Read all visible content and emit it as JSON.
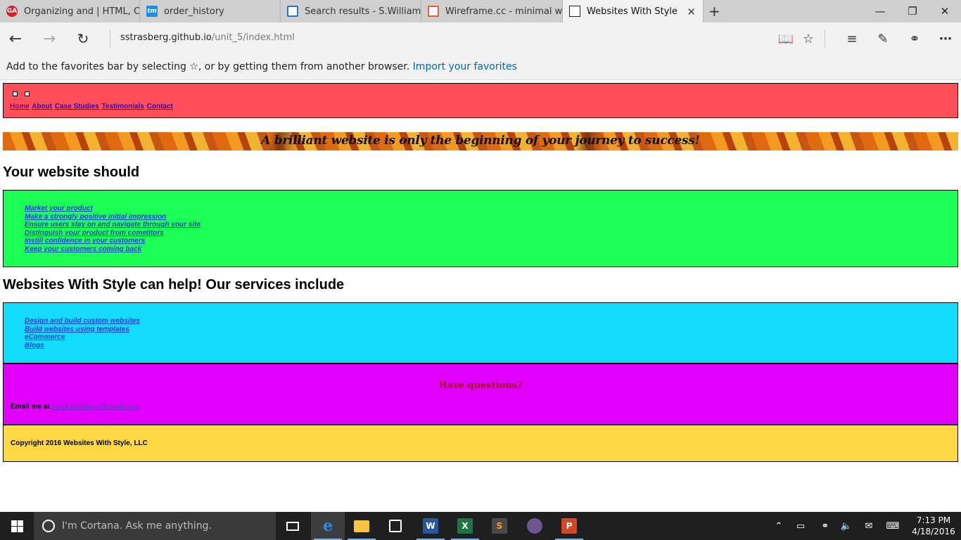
{
  "browser": {
    "tabs": [
      {
        "title": "Organizing and | HTML, CSS",
        "icon": "ga-favicon-icon",
        "active": false
      },
      {
        "title": "order_history",
        "icon": "tm-favicon-icon",
        "active": false
      },
      {
        "title": "Search results - S.Williams",
        "icon": "search-favicon-icon",
        "active": false
      },
      {
        "title": "Wireframe.cc - minimal wire",
        "icon": "wireframe-favicon-icon",
        "active": false
      },
      {
        "title": "Websites With Style",
        "icon": "page-favicon-icon",
        "active": true
      }
    ],
    "tab_favicon_text": {
      "ga": "GA",
      "tm": "tm"
    },
    "url_domain": "sstrasberg.github.io",
    "url_path": "/unit_5/index.html",
    "favorites_bar": {
      "message": "Add to the favorites bar by selecting ☆, or by getting them from another browser. ",
      "link": "Import your favorites"
    },
    "icons": [
      "back-icon",
      "forward-icon",
      "refresh-icon",
      "reading-view-icon",
      "favorite-star-icon",
      "hub-icon",
      "web-note-icon",
      "share-icon",
      "more-icon"
    ]
  },
  "site": {
    "nav": [
      "Home",
      "About",
      "Case Studies",
      "Testimonials",
      "Contact"
    ],
    "banner": "A brilliant website is only the beginning of your journey to success!",
    "heading1": "Your website should",
    "goals": [
      "Market your product",
      "Make a strongly positive initial impression",
      "Ensure users stay on and navigate through your site",
      "Distinguish your product from cometitors",
      "Instill confidence in your customers",
      "Keep your customers coming back"
    ],
    "heading2": "Websites With Style can help! Our services include",
    "services": [
      "Design and build custom websites",
      "Build websites using templates",
      "eCommerce",
      "Blogs"
    ],
    "contact": {
      "title": "Have questions?",
      "email_label": "Email me at ",
      "email": "sandi.strasberg@gmail.com"
    },
    "copyright": "Copyright 2016 Websites With Style, LLC",
    "colors": {
      "header": "#ff4f5b",
      "goals_box": "#1cff54",
      "services_box": "#14dcff",
      "contact_box": "#e100ff",
      "footer": "#ffd843"
    }
  },
  "taskbar": {
    "search_placeholder": "I'm Cortana. Ask me anything.",
    "apps": [
      "task-view-icon",
      "edge-icon",
      "file-explorer-icon",
      "store-icon",
      "word-icon",
      "excel-icon",
      "sublime-icon",
      "github-desktop-icon",
      "powerpoint-icon"
    ],
    "app_letters": {
      "word": "W",
      "excel": "X",
      "sublime": "S",
      "powerpoint": "P"
    },
    "time": "7:13 PM",
    "date": "4/18/2016"
  }
}
